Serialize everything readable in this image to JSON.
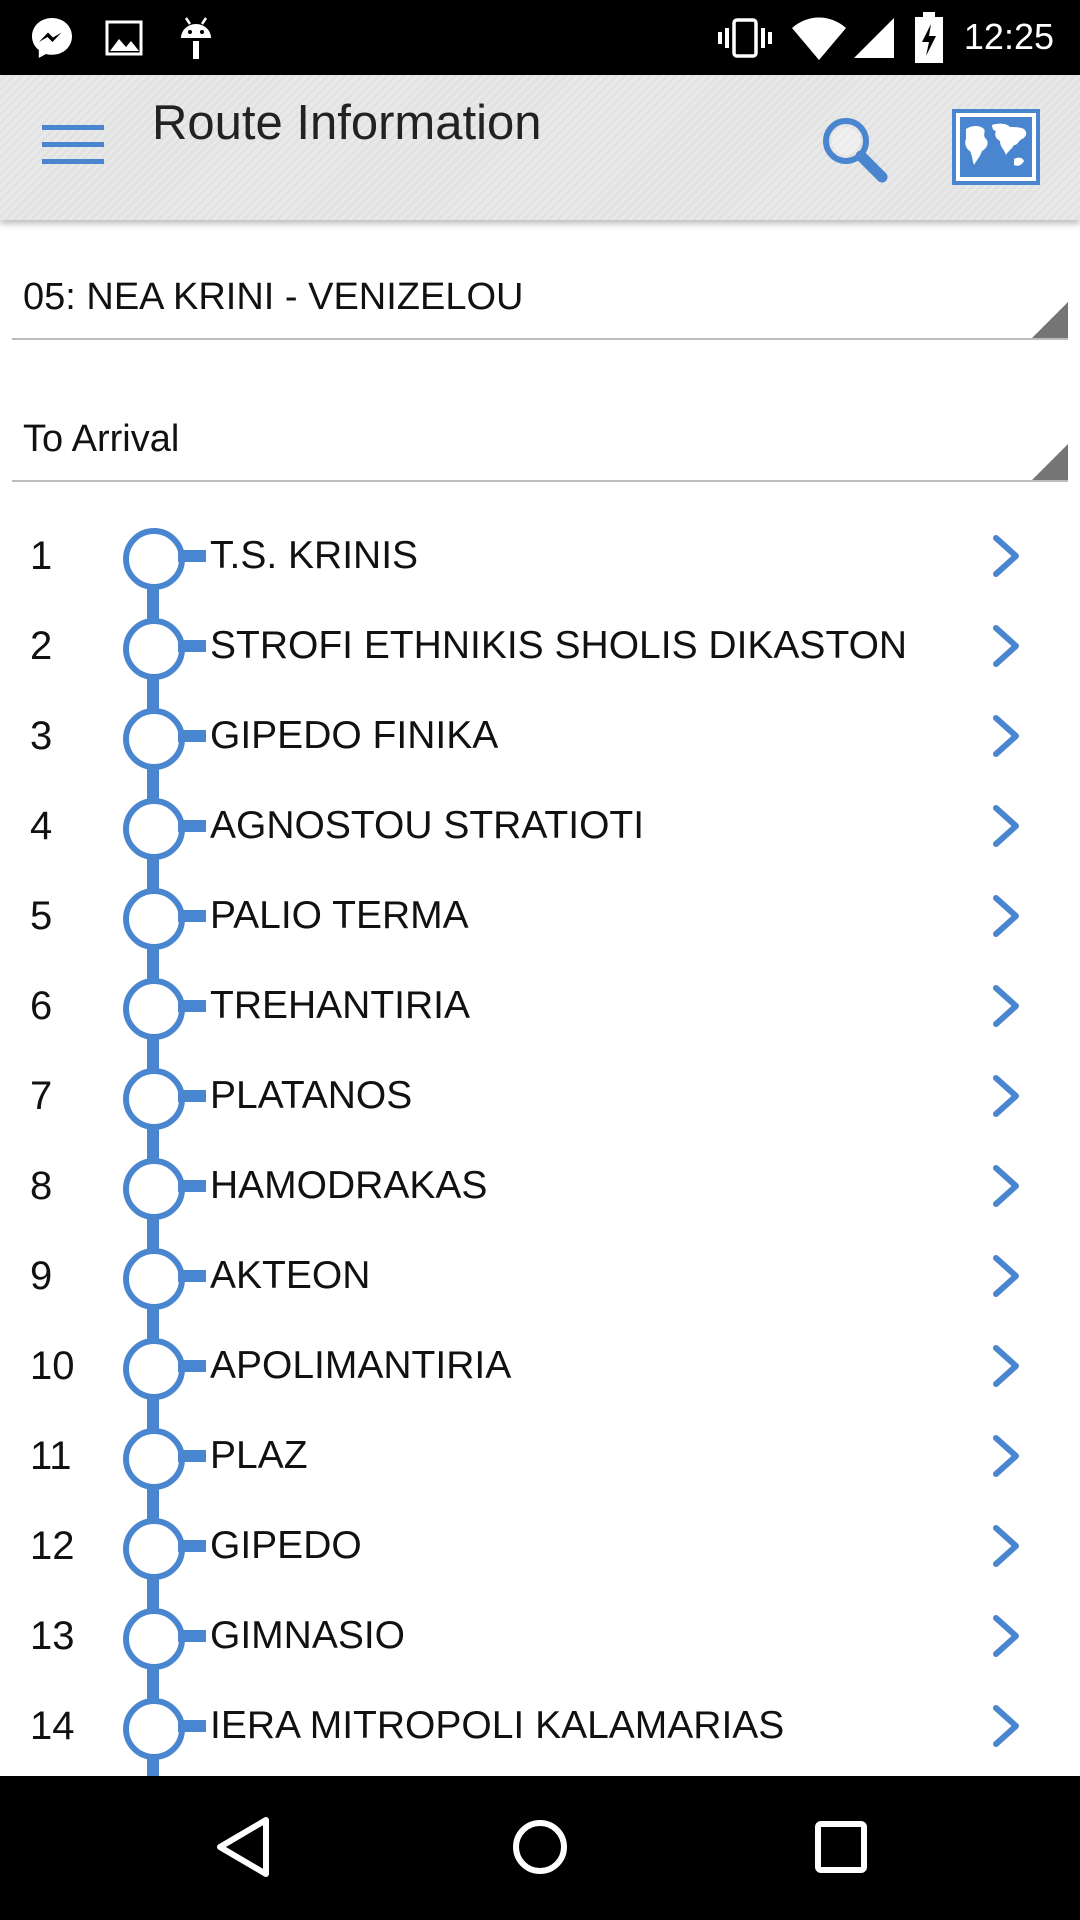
{
  "status_bar": {
    "time": "12:25",
    "left_icons": [
      "messenger-icon",
      "gallery-icon",
      "android-debug-icon"
    ],
    "right_icons": [
      "vibrate-icon",
      "wifi-icon",
      "signal-icon",
      "battery-charging-icon"
    ]
  },
  "header": {
    "title": "Route Information",
    "menu_icon": "hamburger-menu-icon",
    "search_icon": "search-icon",
    "map_icon": "world-map-icon"
  },
  "route_selector": {
    "selected": "05: NEA KRINI - VENIZELOU"
  },
  "direction_selector": {
    "selected": "To Arrival"
  },
  "stops": [
    {
      "number": "1",
      "name": "T.S. KRINIS"
    },
    {
      "number": "2",
      "name": "STROFI ETHNIKIS SHOLIS DIKASTON"
    },
    {
      "number": "3",
      "name": "GIPEDO FINIKA"
    },
    {
      "number": "4",
      "name": "AGNOSTOU STRATIOTI"
    },
    {
      "number": "5",
      "name": "PALIO TERMA"
    },
    {
      "number": "6",
      "name": "TREHANTIRIA"
    },
    {
      "number": "7",
      "name": "PLATANOS"
    },
    {
      "number": "8",
      "name": "HAMODRAKAS"
    },
    {
      "number": "9",
      "name": "AKTEON"
    },
    {
      "number": "10",
      "name": "APOLIMANTIRIA"
    },
    {
      "number": "11",
      "name": "PLAZ"
    },
    {
      "number": "12",
      "name": "GIPEDO"
    },
    {
      "number": "13",
      "name": "GIMNASIO"
    },
    {
      "number": "14",
      "name": "IERA MITROPOLI KALAMARIAS"
    }
  ],
  "colors": {
    "accent": "#4a86cf",
    "status_bar": "#000000",
    "action_bar": "#e6e6e6",
    "text": "#111111"
  },
  "nav_bar": {
    "icons": [
      "back-icon",
      "home-icon",
      "recents-icon"
    ]
  }
}
